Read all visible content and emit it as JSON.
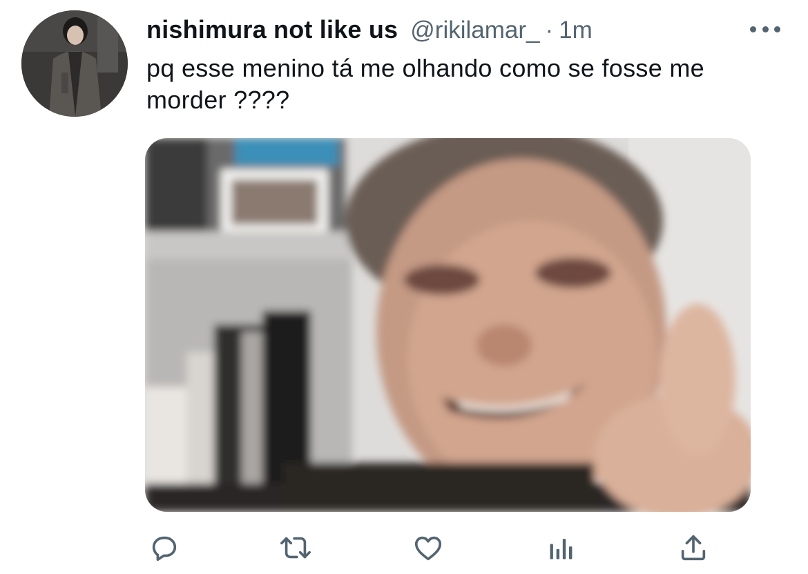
{
  "tweet": {
    "display_name": "nishimura not like us",
    "handle": "@rikilamar_",
    "separator": "·",
    "time": "1m",
    "text": "pq esse menino tá me olhando como se fosse me morder ????"
  },
  "colors": {
    "text": "#0f1419",
    "secondary": "#536471",
    "background": "#ffffff"
  },
  "icons": {
    "more": "more-horizontal-icon",
    "reply": "reply-icon",
    "retweet": "retweet-icon",
    "like": "heart-icon",
    "views": "analytics-icon",
    "share": "share-icon"
  }
}
